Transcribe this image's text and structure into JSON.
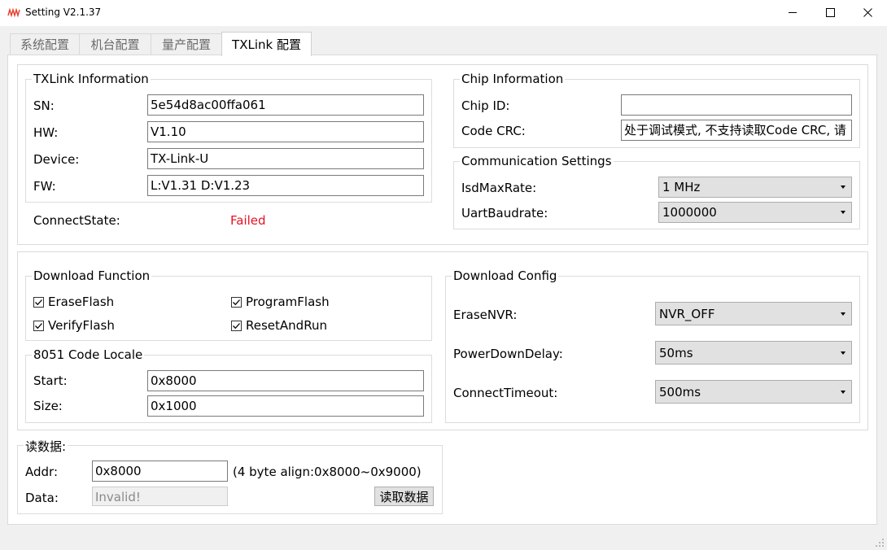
{
  "window": {
    "title": "Setting  V2.1.37",
    "app_icon": "waveform-icon",
    "controls": [
      "minimize-icon",
      "maximize-icon",
      "close-icon"
    ]
  },
  "tabs": [
    {
      "label": "系统配置",
      "active": false
    },
    {
      "label": "机台配置",
      "active": false
    },
    {
      "label": "量产配置",
      "active": false
    },
    {
      "label": "TXLink 配置",
      "active": true
    }
  ],
  "txlink_info": {
    "legend": "TXLink Information",
    "fields": [
      {
        "label": "SN:",
        "value": "5e54d8ac00ffa061"
      },
      {
        "label": "HW:",
        "value": "V1.10"
      },
      {
        "label": "Device:",
        "value": "TX-Link-U"
      },
      {
        "label": "FW:",
        "value": "L:V1.31  D:V1.23"
      }
    ],
    "connect_state_label": "ConnectState:",
    "connect_state_value": "Failed"
  },
  "chip_info": {
    "legend": "Chip Information",
    "chip_id_label": "Chip ID:",
    "chip_id_value": "",
    "code_crc_label": "Code CRC:",
    "code_crc_value": "处于调试模式, 不支持读取Code CRC, 请"
  },
  "comm_settings": {
    "legend": "Communication Settings",
    "isd_label": "IsdMaxRate:",
    "isd_value": "1 MHz",
    "uart_label": "UartBaudrate:",
    "uart_value": "1000000"
  },
  "download_function": {
    "legend": "Download Function",
    "options": [
      {
        "label": "EraseFlash",
        "checked": true
      },
      {
        "label": "ProgramFlash",
        "checked": true
      },
      {
        "label": "VerifyFlash",
        "checked": true
      },
      {
        "label": "ResetAndRun",
        "checked": true
      }
    ]
  },
  "code_locale": {
    "legend": "8051 Code Locale",
    "start_label": "Start:",
    "start_value": "0x8000",
    "size_label": "Size:",
    "size_value": "0x1000"
  },
  "download_config": {
    "legend": "Download Config",
    "erase_nvr_label": "EraseNVR:",
    "erase_nvr_value": "NVR_OFF",
    "power_down_label": "PowerDownDelay:",
    "power_down_value": "50ms",
    "connect_timeout_label": "ConnectTimeout:",
    "connect_timeout_value": "500ms"
  },
  "read_data": {
    "legend": "读数据:",
    "addr_label": "Addr:",
    "addr_value": "0x8000",
    "align_hint": "(4 byte align:0x8000~0x9000)",
    "data_label": "Data:",
    "data_value": "Invalid!",
    "read_button": "读取数据"
  },
  "colors": {
    "error": "#e81123",
    "app_icon": "#e8392a"
  }
}
